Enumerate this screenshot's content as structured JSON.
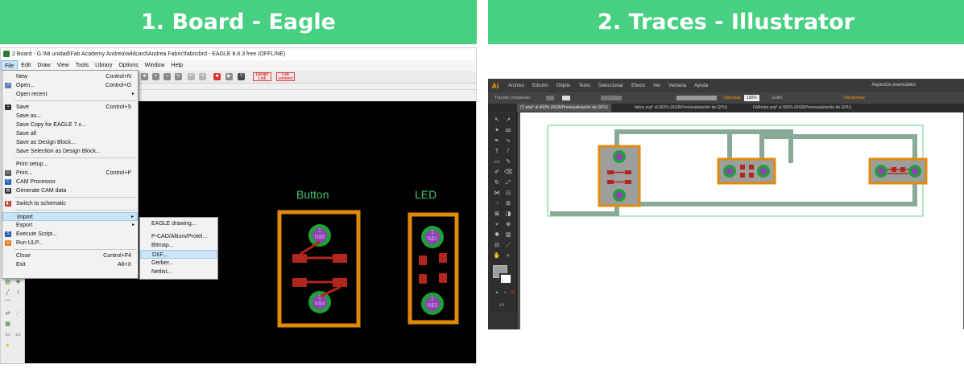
{
  "banners": {
    "left": "1. Board - Eagle",
    "right": "2. Traces  - Illustrator"
  },
  "eagle": {
    "title": "2 Board - G:\\Mi unidad\\Fab Academy Andrea\\wildcard\\Andrea Fabric\\fabricbrd - EAGLE 8.6.3 free (OFFLINE)",
    "menubar": [
      "File",
      "Edit",
      "Draw",
      "View",
      "Tools",
      "Library",
      "Options",
      "Window",
      "Help"
    ],
    "toolbar_buttons": [
      "Design Link",
      "Fab connect"
    ],
    "file_menu": {
      "new": {
        "label": "New",
        "shortcut": "Control+N"
      },
      "open": {
        "label": "Open...",
        "shortcut": "Control+O"
      },
      "open_recent": {
        "label": "Open recent"
      },
      "save": {
        "label": "Save",
        "shortcut": "Control+S"
      },
      "save_as": {
        "label": "Save as..."
      },
      "save_copy": {
        "label": "Save Copy for EAGLE 7.x..."
      },
      "save_all": {
        "label": "Save all"
      },
      "save_design_block": {
        "label": "Save as Design Block..."
      },
      "save_selection": {
        "label": "Save Selection as Design Block..."
      },
      "print_setup": {
        "label": "Print setup..."
      },
      "print": {
        "label": "Print...",
        "shortcut": "Control+P"
      },
      "cam_processor": {
        "label": "CAM Processor"
      },
      "generate_cam": {
        "label": "Generate CAM data"
      },
      "switch_schematic": {
        "label": "Switch to schematic"
      },
      "import": {
        "label": "Import"
      },
      "export": {
        "label": "Export"
      },
      "execute_script": {
        "label": "Execute Script..."
      },
      "run_ulp": {
        "label": "Run ULP..."
      },
      "close": {
        "label": "Close",
        "shortcut": "Control+F4"
      },
      "exit": {
        "label": "Exit",
        "shortcut": "Alt+X"
      }
    },
    "import_menu": {
      "eagle_drawing": "EAGLE drawing...",
      "pcad": "P-CAD/Altium/Protel...",
      "bitmap": "Bitmap...",
      "dxf": "DXF...",
      "gerber": "Gerber...",
      "netlist": "Netlist..."
    },
    "board": {
      "button_label": "Button",
      "led_label": "LED",
      "pads": {
        "button_top_num": "1",
        "button_top_name": "N$6",
        "button_bottom_num": "1",
        "button_bottom_name": "N$4",
        "led_top_num": "1",
        "led_top_name": "N$1",
        "led_bottom_num": "1",
        "led_bottom_name": "N$3"
      }
    }
  },
  "illustrator": {
    "logo": "Ai",
    "menubar": [
      "Archivo",
      "Edición",
      "Objeto",
      "Texto",
      "Seleccionar",
      "Efecto",
      "Ver",
      "Ventana",
      "Ayuda"
    ],
    "workspace": "Aspectos esenciales",
    "tabs": [
      "(*) png* al 400% (RGB/Previsualización de GPU)",
      "fabric.svg* al 902% (RGB/Previsualización de GPU)",
      "FABrubs.svg* al 902% (RGB/Previsualización de GPU)"
    ],
    "control_labels": {
      "selection": "Trazado compuesto",
      "opacity_label": "Opacidad",
      "opacity_value": "100%",
      "style": "Estilo",
      "transform": "Transformar"
    }
  },
  "colors": {
    "banner": "#47cf82",
    "board_outline": "#e08a0a",
    "pad_ring": "#1fa13a",
    "pad_center": "#8e44ad",
    "trace_red": "#b3261e",
    "eagle_label": "#3ec86e",
    "ai_trace": "#8aaa98",
    "ai_component_fill": "#9e9e9e"
  },
  "icons": [
    "new-file-icon",
    "open-icon",
    "save-icon",
    "print-icon",
    "cam-icon",
    "generate-cam-icon",
    "schematic-icon",
    "script-icon",
    "ulp-icon",
    "eagle-app-icon"
  ]
}
